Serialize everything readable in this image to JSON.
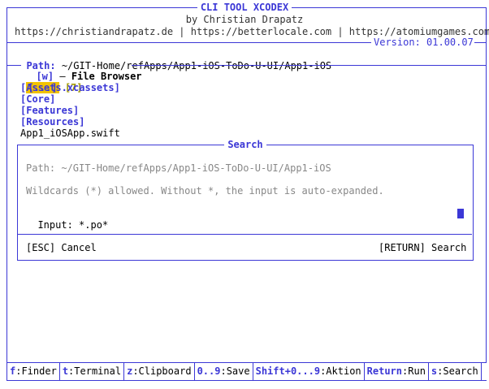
{
  "header": {
    "title": "CLI TOOL XCODEX",
    "author": "by Christian Drapatz",
    "links": "https://christiandrapatz.de | https://betterlocale.com | https://atomiumgames.com",
    "version": "Version: 01.00.07"
  },
  "path": {
    "label": "Path:",
    "value": "~/GIT-Home/refApps/App1-iOS-ToDo-U-UI/App1-iOS"
  },
  "browser": {
    "hotkey": "[w]",
    "title": "File Browser",
    "selected": "[...]",
    "count": "[7]",
    "items": [
      "[Assets.xcassets]",
      "[Core]",
      "[Features]",
      "[Resources]",
      "App1_iOSApp.swift"
    ]
  },
  "search": {
    "title": "Search",
    "path": "Path: ~/GIT-Home/refApps/App1-iOS-ToDo-U-UI/App1-iOS",
    "hint": "Wildcards (*) allowed. Without *, the input is auto-expanded.",
    "input_label": "Input:",
    "input_value": "*.po*",
    "cancel": "[ESC] Cancel",
    "confirm": "[RETURN] Search"
  },
  "footer": [
    {
      "key": "f",
      "label": ":Finder"
    },
    {
      "key": "t",
      "label": ":Terminal"
    },
    {
      "key": "z",
      "label": ":Clipboard"
    },
    {
      "key": "0..9",
      "label": ":Save"
    },
    {
      "key": "Shift+0...9",
      "label": ":Aktion"
    },
    {
      "key": "Return",
      "label": ":Run"
    },
    {
      "key": "s",
      "label": ":Search"
    }
  ],
  "colors": {
    "accent": "#3b37d6",
    "selection": "#f2c200",
    "count": "#a39a00"
  }
}
